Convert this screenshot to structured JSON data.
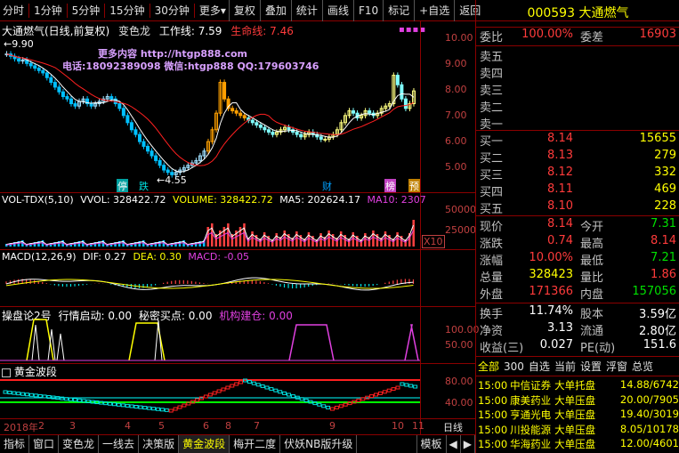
{
  "toolbar": {
    "periods": [
      "分时",
      "1分钟",
      "5分钟",
      "15分钟",
      "30分钟",
      "更多▾"
    ],
    "buttons": [
      "复权",
      "叠加",
      "统计",
      "画线",
      "F10",
      "标记",
      "+自选",
      "返回"
    ]
  },
  "stock": {
    "code": "000593",
    "name": "大通燃气"
  },
  "main_panel": {
    "title": "大通燃气(日线,前复权)",
    "indicator": "变色龙",
    "work_line": "工作线: 7.59",
    "life_line": "生命线: 7.46",
    "high_label": "9.90",
    "low_label": "4.55",
    "promo1": "更多内容 http://htgp888.com",
    "promo2": "电话:18092389098 微信:htgp888 QQ:179603746",
    "mark_labels": [
      "停",
      "跌",
      "财",
      "榜",
      "预"
    ],
    "yticks": [
      "10.00",
      "9.00",
      "8.00",
      "7.00",
      "6.00",
      "5.00"
    ]
  },
  "vol_panel": {
    "title": "VOL-TDX(5,10)",
    "vvol": "VVOL: 328422.72",
    "volume": "VOLUME: 328422.72",
    "ma5": "MA5: 202624.17",
    "ma10": "MA10: 2307",
    "yticks": [
      "50000",
      "25000"
    ],
    "unit": "X10"
  },
  "macd_panel": {
    "title": "MACD(12,26,9)",
    "dif": "DIF: 0.27",
    "dea": "DEA: 0.30",
    "macd": "MACD: -0.05"
  },
  "cp_panel": {
    "title": "操盘论2号",
    "a": "行情启动: 0.00",
    "b": "秘密买点: 0.00",
    "c": "机构建仓: 0.00",
    "yticks": [
      "100.00",
      "50.00"
    ]
  },
  "gold_panel": {
    "title": "黄金波段",
    "yticks": [
      "80.00",
      "40.00"
    ]
  },
  "time_axis": {
    "labels": [
      "2018年",
      "2",
      "3",
      "4",
      "5",
      "6",
      "7",
      "8",
      "9",
      "10",
      "11"
    ],
    "right_label": "日线"
  },
  "bottom_tabs": [
    "指标",
    "窗口",
    "变色龙",
    "一线去",
    "决策版",
    "黄金波段",
    "梅开二度",
    "伏妖NB版升级",
    "模板"
  ],
  "quote": {
    "weibi_label": "委比",
    "weibi": "100.00%",
    "weicha_label": "委差",
    "weicha": "16903",
    "sells": [
      {
        "label": "卖五",
        "price": "",
        "vol": ""
      },
      {
        "label": "卖四",
        "price": "",
        "vol": ""
      },
      {
        "label": "卖三",
        "price": "",
        "vol": ""
      },
      {
        "label": "卖二",
        "price": "",
        "vol": ""
      },
      {
        "label": "卖一",
        "price": "",
        "vol": ""
      }
    ],
    "buys": [
      {
        "label": "买一",
        "price": "8.14",
        "vol": "15655"
      },
      {
        "label": "买二",
        "price": "8.13",
        "vol": "279"
      },
      {
        "label": "买三",
        "price": "8.12",
        "vol": "332"
      },
      {
        "label": "买四",
        "price": "8.11",
        "vol": "469"
      },
      {
        "label": "买五",
        "price": "8.10",
        "vol": "228"
      }
    ],
    "stats": [
      {
        "l1": "现价",
        "v1": "8.14",
        "c1": "red",
        "l2": "今开",
        "v2": "7.31",
        "c2": "grn"
      },
      {
        "l1": "涨跌",
        "v1": "0.74",
        "c1": "red",
        "l2": "最高",
        "v2": "8.14",
        "c2": "red"
      },
      {
        "l1": "涨幅",
        "v1": "10.00%",
        "c1": "red",
        "l2": "最低",
        "v2": "7.21",
        "c2": "grn"
      },
      {
        "l1": "总量",
        "v1": "328423",
        "c1": "yel",
        "l2": "量比",
        "v2": "1.86",
        "c2": "red"
      },
      {
        "l1": "外盘",
        "v1": "171366",
        "c1": "red",
        "l2": "内盘",
        "v2": "157056",
        "c2": "grn"
      }
    ],
    "stats2": [
      {
        "l1": "换手",
        "v1": "11.74%",
        "l2": "股本",
        "v2": "3.59亿"
      },
      {
        "l1": "净资",
        "v1": "3.13",
        "l2": "流通",
        "v2": "2.80亿"
      },
      {
        "l1": "收益(三)",
        "v1": "0.027",
        "l2": "PE(动)",
        "v2": "151.6"
      }
    ],
    "filter_tabs": [
      "全部",
      "300",
      "自选",
      "当前",
      "设置",
      "浮窗",
      "总览"
    ],
    "news": [
      {
        "time": "15:00",
        "name": "中信证券",
        "type": "大单托盘",
        "val": "14.88/6742"
      },
      {
        "time": "15:00",
        "name": "康美药业",
        "type": "大单压盘",
        "val": "20.00/7905"
      },
      {
        "time": "15:00",
        "name": "亨通光电",
        "type": "大单压盘",
        "val": "19.40/3019"
      },
      {
        "time": "15:00",
        "name": "川投能源",
        "type": "大单压盘",
        "val": "8.05/10178"
      },
      {
        "time": "15:00",
        "name": "华海药业",
        "type": "大单压盘",
        "val": "12.00/4601"
      }
    ]
  },
  "chart_data": {
    "type": "line",
    "close": [
      9.7,
      9.6,
      9.5,
      9.4,
      9.45,
      9.3,
      9.2,
      9.1,
      9.0,
      8.9,
      8.7,
      8.5,
      8.3,
      8.1,
      7.9,
      7.8,
      7.6,
      7.5,
      7.7,
      7.8,
      7.6,
      7.5,
      7.6,
      7.7,
      7.8,
      7.9,
      7.8,
      7.6,
      7.4,
      7.1,
      6.8,
      6.5,
      6.3,
      6.0,
      5.8,
      5.6,
      5.4,
      5.2,
      5.0,
      4.8,
      4.7,
      4.6,
      4.7,
      4.8,
      4.9,
      5.0,
      5.1,
      5.2,
      5.4,
      5.6,
      6.0,
      6.5,
      7.2,
      8.5,
      7.8,
      7.4,
      7.3,
      7.2,
      7.1,
      7.0,
      6.9,
      6.8,
      6.7,
      6.6,
      6.5,
      6.4,
      6.3,
      6.4,
      6.5,
      6.6,
      6.5,
      6.4,
      6.3,
      6.2,
      6.3,
      6.4,
      6.3,
      6.2,
      6.1,
      6.1,
      6.2,
      6.3,
      6.5,
      6.8,
      7.1,
      7.3,
      7.2,
      7.0,
      7.1,
      7.3,
      7.2,
      7.1,
      7.2,
      7.4,
      7.5,
      7.6,
      8.8,
      8.4,
      7.8,
      7.4,
      7.6,
      8.14
    ],
    "ylim": [
      4.2,
      10.4
    ]
  }
}
